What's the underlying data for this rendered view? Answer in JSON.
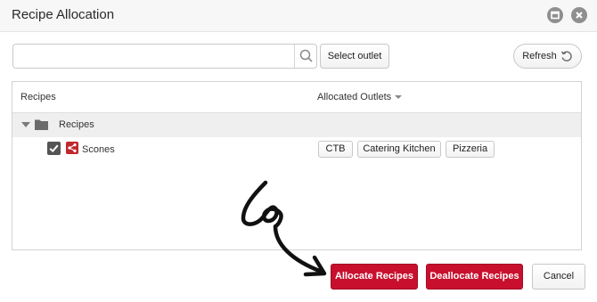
{
  "window": {
    "title": "Recipe Allocation"
  },
  "toolbar": {
    "search_value": "",
    "search_placeholder": "",
    "select_outlet_label": "Select outlet",
    "refresh_label": "Refresh"
  },
  "grid": {
    "columns": [
      "Recipes",
      "Allocated Outlets"
    ],
    "group": {
      "label": "Recipes",
      "expanded": true
    },
    "rows": [
      {
        "name": "Scones",
        "checked": true,
        "outlets": [
          "CTB",
          "Catering Kitchen",
          "Pizzeria"
        ]
      }
    ]
  },
  "footer": {
    "allocate_label": "Allocate Recipes",
    "deallocate_label": "Deallocate Recipes",
    "cancel_label": "Cancel"
  },
  "colors": {
    "accent": "#c8102e",
    "header_bg": "#f7f7f7",
    "group_bg": "#efefef"
  }
}
